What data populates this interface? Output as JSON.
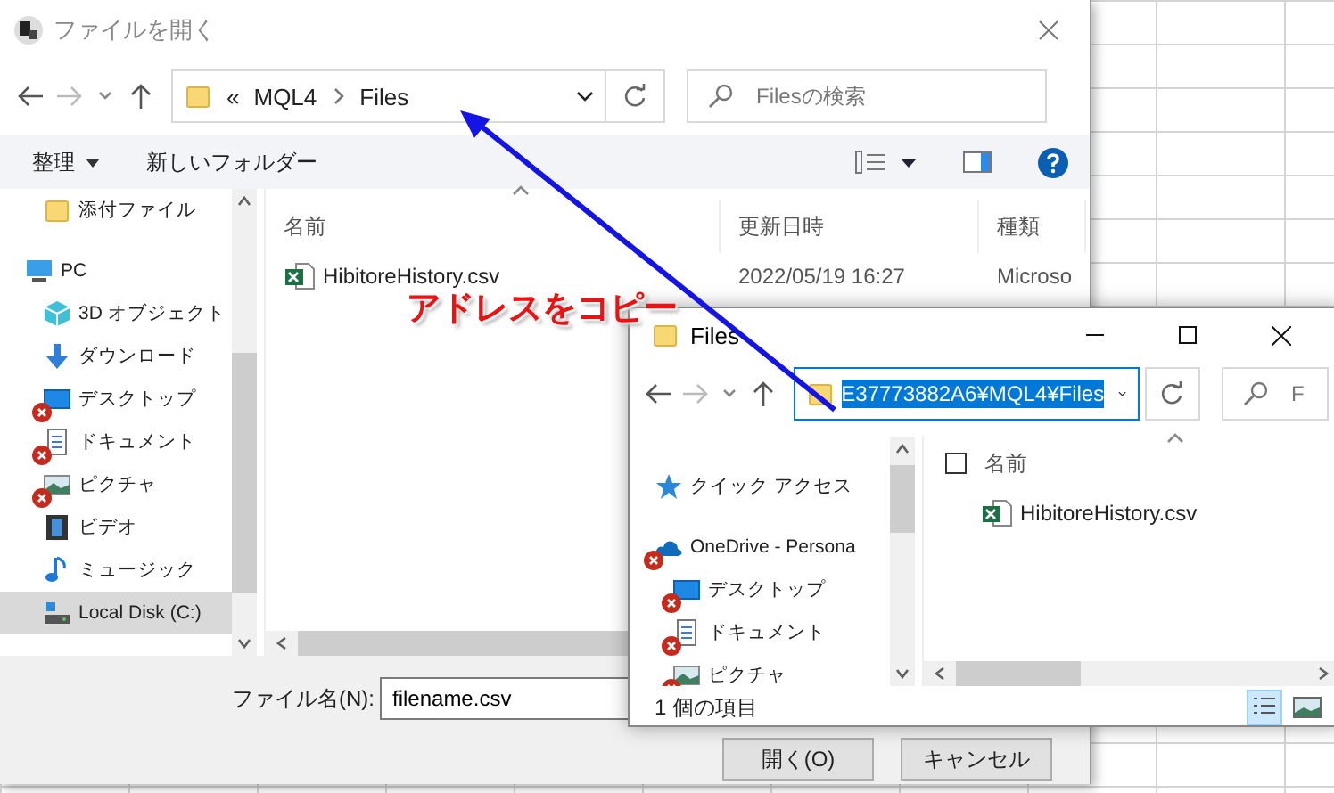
{
  "open_dialog": {
    "title": "ファイルを開く",
    "address": {
      "overflow_mark": "«",
      "crumbs": [
        "MQL4",
        "Files"
      ]
    },
    "search": {
      "placeholder": "Filesの検索"
    },
    "toolbar": {
      "organize": "整理",
      "new_folder": "新しいフォルダー"
    },
    "nav_items": [
      {
        "children": [
          {
            "label": "添付ファイル",
            "kind": "folder",
            "error": false,
            "selected": false
          }
        ]
      },
      {
        "label": "PC",
        "kind": "pc",
        "error": false,
        "selected": false,
        "children": [
          {
            "label": "3D オブジェクト",
            "kind": "cube",
            "error": false,
            "selected": false
          },
          {
            "label": "ダウンロード",
            "kind": "download",
            "error": false,
            "selected": false
          },
          {
            "label": "デスクトップ",
            "kind": "desktop",
            "error": true,
            "selected": false
          },
          {
            "label": "ドキュメント",
            "kind": "document",
            "error": true,
            "selected": false
          },
          {
            "label": "ピクチャ",
            "kind": "picture",
            "error": true,
            "selected": false
          },
          {
            "label": "ビデオ",
            "kind": "video",
            "error": false,
            "selected": false
          },
          {
            "label": "ミュージック",
            "kind": "music",
            "error": false,
            "selected": false
          },
          {
            "label": "Local Disk (C:)",
            "kind": "disk",
            "error": false,
            "selected": true
          }
        ]
      }
    ],
    "columns": [
      "名前",
      "更新日時",
      "種類"
    ],
    "files": [
      {
        "name": "HibitoreHistory.csv",
        "modified": "2022/05/19 16:27",
        "type": "Microso"
      }
    ],
    "filename": {
      "label": "ファイル名(N):",
      "value": "filename.csv"
    },
    "buttons": [
      "開く(O)",
      "キャンセル"
    ]
  },
  "explorer": {
    "title": "Files",
    "address": {
      "value": "E37773882A6¥MQL4¥Files",
      "selected": true
    },
    "search": {
      "placeholder": "F"
    },
    "nav_items": [
      {
        "label": "クイック アクセス",
        "kind": "star",
        "error": false,
        "selected": false
      },
      {
        "label": "OneDrive - Persona",
        "kind": "cloud",
        "error": true,
        "selected": false,
        "children": [
          {
            "label": "デスクトップ",
            "kind": "desktop",
            "error": true,
            "selected": false
          },
          {
            "label": "ドキュメント",
            "kind": "document",
            "error": true,
            "selected": false
          },
          {
            "label": "ピクチャ",
            "kind": "picture",
            "error": true,
            "selected": false
          }
        ]
      }
    ],
    "select_all": {
      "checked": false
    },
    "columns": [
      "名前"
    ],
    "files": [
      {
        "name": "HibitoreHistory.csv"
      }
    ],
    "status": "1 個の項目",
    "views": [
      {
        "kind": "details",
        "selected": true
      },
      {
        "kind": "tiles",
        "selected": false
      }
    ]
  },
  "annotation": {
    "text": "アドレスをコピー"
  }
}
